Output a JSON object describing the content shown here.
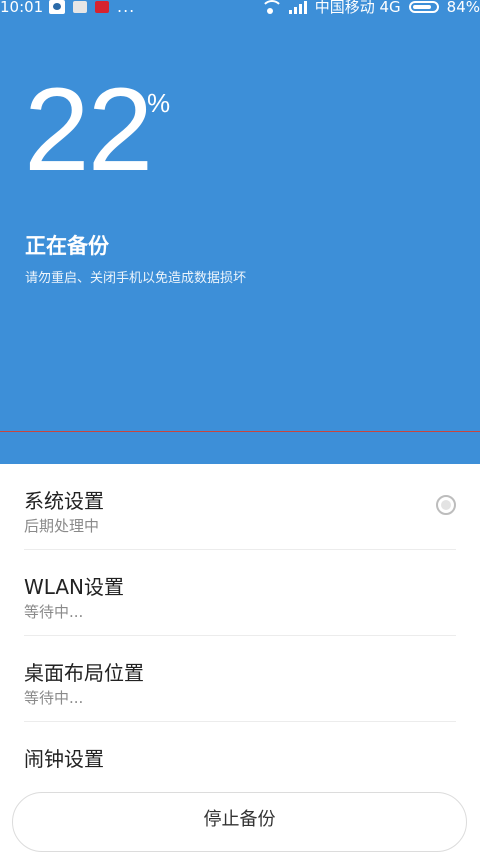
{
  "status_bar": {
    "time": "10:01",
    "more": "...",
    "carrier": "中国移动 4G",
    "battery_text": "84%",
    "battery_level": 0.84
  },
  "progress": {
    "value": "22",
    "unit": "%"
  },
  "backup": {
    "title": "正在备份",
    "subtitle": "请勿重启、关闭手机以免造成数据损坏"
  },
  "items": [
    {
      "name": "系统设置",
      "state": "后期处理中"
    },
    {
      "name": "WLAN设置",
      "state": "等待中..."
    },
    {
      "name": "桌面布局位置",
      "state": "等待中..."
    },
    {
      "name": "闹钟设置",
      "state": ""
    }
  ],
  "stop_button": {
    "label": "停止备份"
  },
  "colors": {
    "header_bg": "#3d8fd8",
    "divider_red": "#c8463f"
  }
}
